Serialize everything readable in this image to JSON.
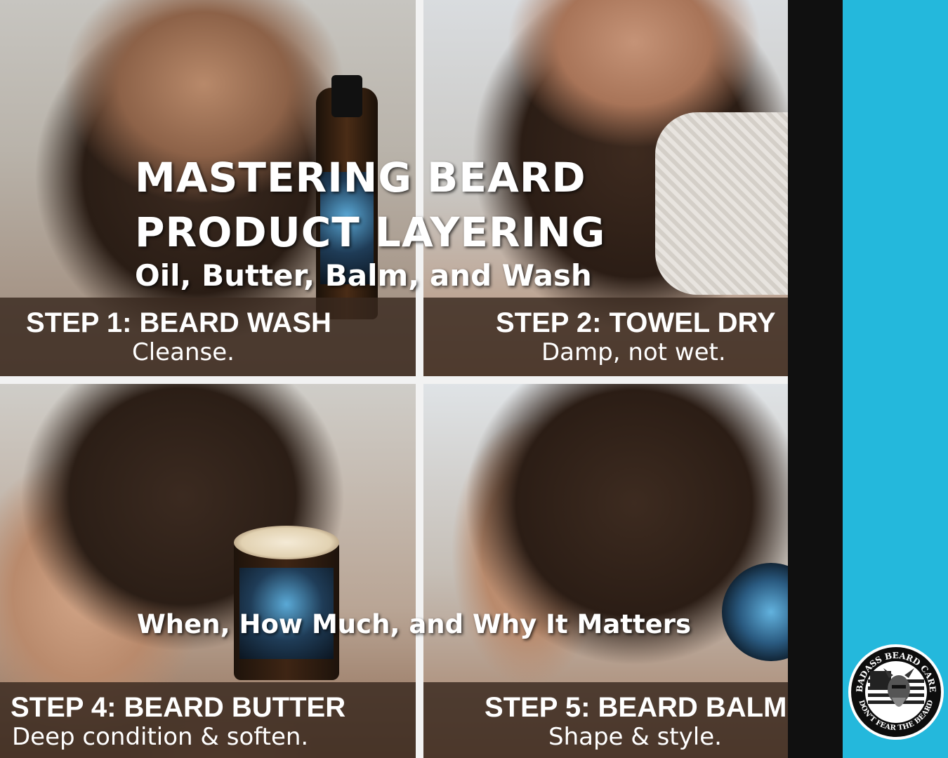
{
  "headline": {
    "line1": "MASTERING BEARD",
    "line2": "PRODUCT LAYERING",
    "subtitle": "Oil, Butter, Balm, and Wash"
  },
  "tagline": "When, How Much, and Why It Matters",
  "steps": [
    {
      "title": "STEP 1: BEARD WASH",
      "subtitle": "Cleanse."
    },
    {
      "title": "STEP 2: TOWEL DRY",
      "subtitle": "Damp, not wet."
    },
    {
      "title": "STEP 4: BEARD BUTTER",
      "subtitle": "Deep condition & soften."
    },
    {
      "title": "STEP 5: BEARD BALM",
      "subtitle": "Shape & style."
    }
  ],
  "badge": {
    "top_text": "BADASS BEARD CARE",
    "bottom_text": "DON'T FEAR THE BEARD"
  },
  "colors": {
    "accent": "#24b8dc",
    "caption_bg": "#38281e",
    "dark_strip": "#101010"
  }
}
